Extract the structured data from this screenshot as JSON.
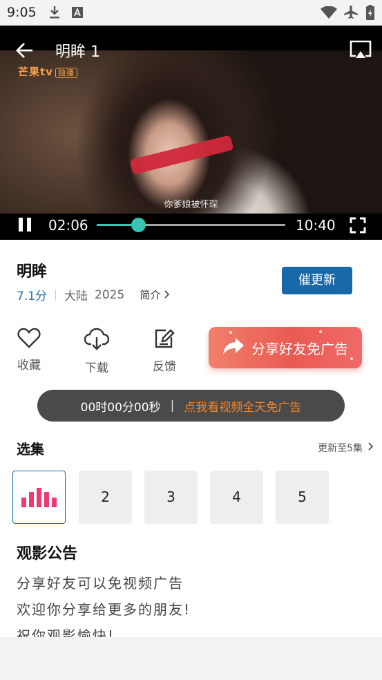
{
  "status_bar": {
    "time": "9:05",
    "icons": [
      "download-icon",
      "a-notification-icon",
      "wifi-icon",
      "airplane-icon",
      "battery-icon"
    ]
  },
  "player": {
    "title": "明眸 1",
    "logo_text": "芒果tv",
    "logo_badge": "独播",
    "subtitle": "你爹娘被怀琛",
    "current_time": "02:06",
    "total_time": "10:40",
    "progress": 0.22,
    "accent_color": "#3cc2b4"
  },
  "show": {
    "title": "明眸",
    "score": "7.1分",
    "region": "大陆",
    "year": "2025",
    "intro_label": "简介",
    "urge_label": "催更新"
  },
  "actions": {
    "favorite": "收藏",
    "download": "下载",
    "feedback": "反馈",
    "share": "分享好友免广告"
  },
  "ad_bar": {
    "timer": "00时00分00秒",
    "separator": "|",
    "cta": "点我看视频全天免广告"
  },
  "episodes": {
    "title": "选集",
    "update_text": "更新至5集",
    "items": [
      "1",
      "2",
      "3",
      "4",
      "5"
    ],
    "playing_index": 0
  },
  "notice": {
    "title": "观影公告",
    "lines": [
      "分享好友可以免视频广告",
      "欢迎你分享给更多的朋友!",
      "祝你观影愉快!"
    ]
  },
  "colors": {
    "brand_blue": "#1968a8",
    "share_red": "#ea5a52",
    "cta_orange": "#f5842a",
    "playing_pink": "#ec3a73"
  }
}
